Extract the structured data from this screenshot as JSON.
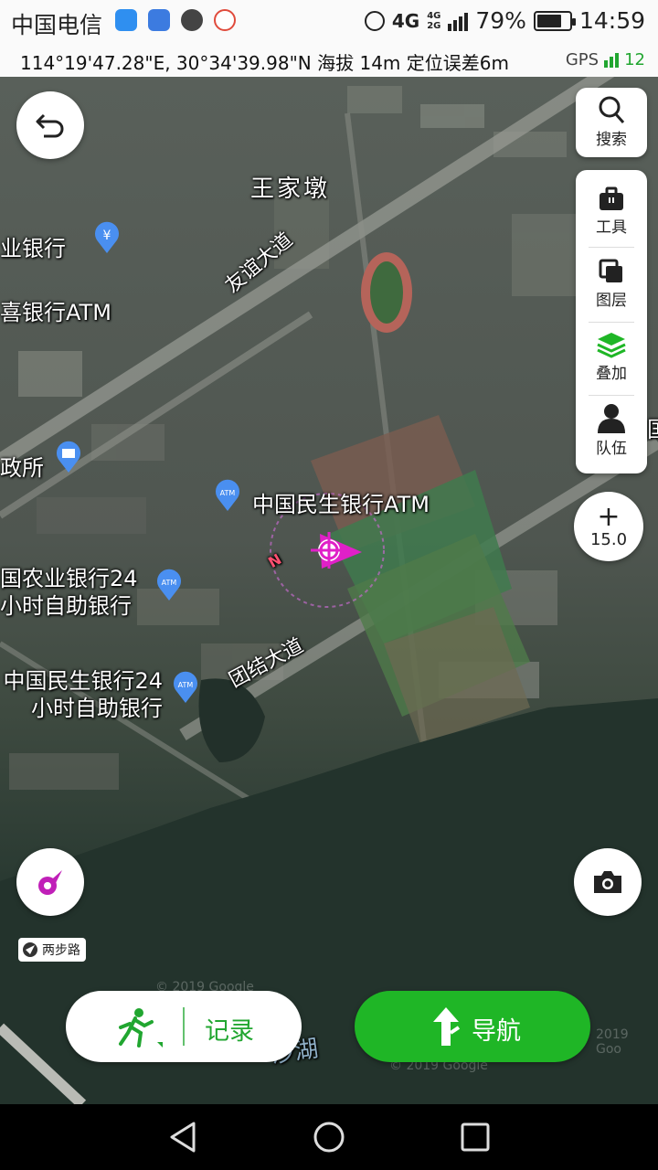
{
  "status_bar": {
    "carrier": "中国电信",
    "network": "4G",
    "battery": "79%",
    "battery_level": 0.79,
    "time": "14:59"
  },
  "coord_bar": {
    "coords": "114°19'47.28\"E, 30°34'39.98\"N",
    "altitude": "海拔 14m",
    "accuracy": "定位误差6m",
    "gps_label": "GPS",
    "gps_count": "12"
  },
  "map_labels": {
    "area1": "王家墩",
    "road1": "友谊大道",
    "road2": "团结大道",
    "poi1": "业银行",
    "poi2": "喜银行ATM",
    "poi3": "政所",
    "poi4": "中国民生银行ATM",
    "poi5_l1": "国农业银行24",
    "poi5_l2": "小时自助银行",
    "poi6_l1": "中国民生银行24",
    "poi6_l2": "小时自助银行",
    "lake": "沙湖",
    "edge1": "国",
    "compass": "N"
  },
  "tools": {
    "search": "搜索",
    "tool": "工具",
    "layer": "图层",
    "overlay": "叠加",
    "team": "队伍"
  },
  "zoom": {
    "symbol": "+",
    "level": "15.0"
  },
  "tag": {
    "label": "两步路"
  },
  "buttons": {
    "record": "记录",
    "navigate": "导航"
  },
  "copyright": {
    "c1": "© 2019 Google",
    "c2": "© 2019 Google",
    "c3": "2019 Goo"
  },
  "colors": {
    "accent": "#1fb626",
    "marker": "#e020c8"
  }
}
